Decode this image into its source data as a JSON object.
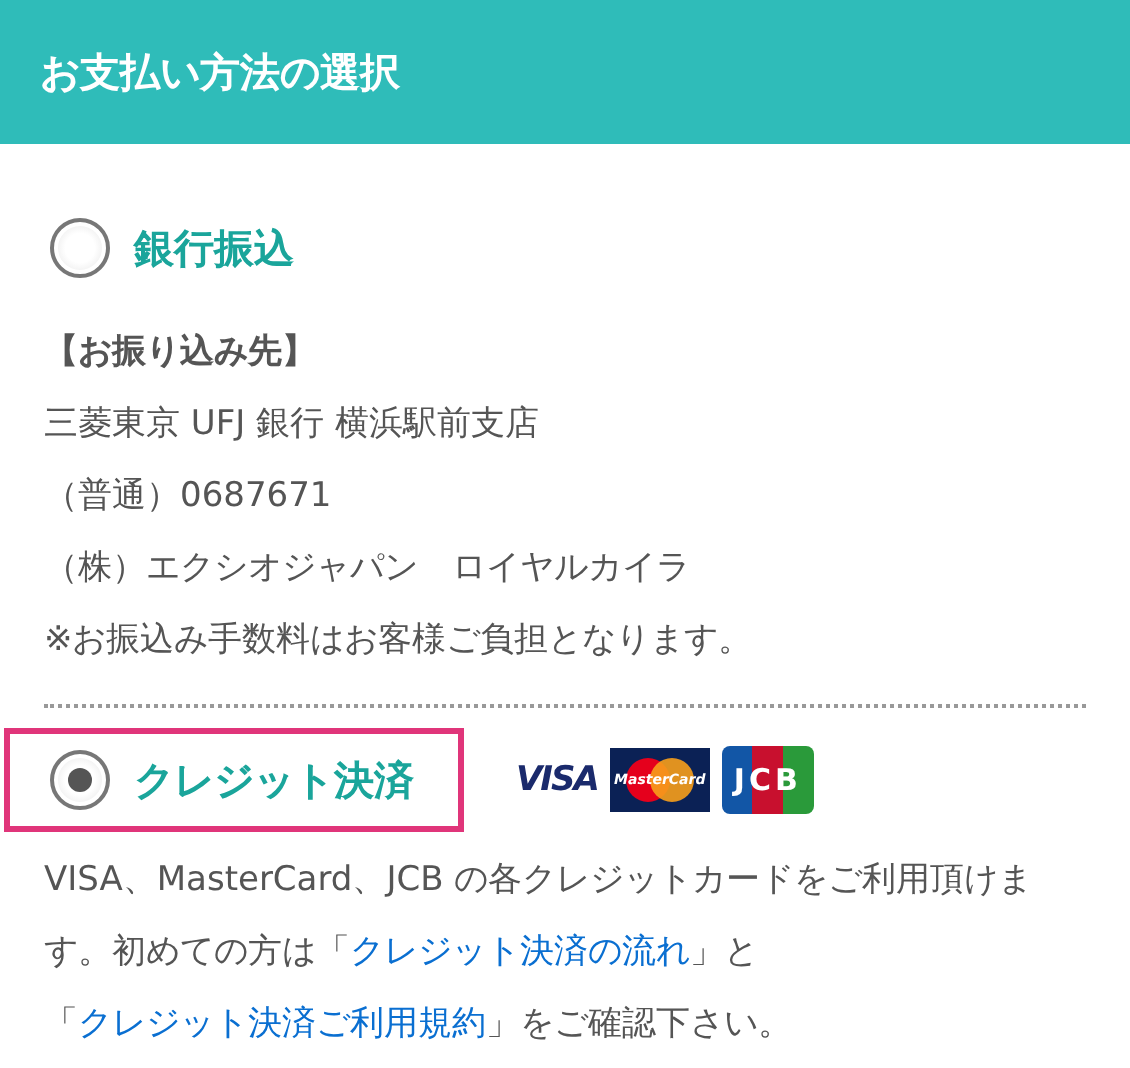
{
  "header": {
    "title": "お支払い方法の選択"
  },
  "options": [
    {
      "label": "銀行振込",
      "selected": false,
      "details": [
        {
          "kind": "heading",
          "text": "【お振り込み先】"
        },
        {
          "kind": "line",
          "text": "三菱東京 UFJ 銀行 横浜駅前支店"
        },
        {
          "kind": "line",
          "text": "（普通）0687671"
        },
        {
          "kind": "line",
          "text": "（株）エクシオジャパン　ロイヤルカイラ"
        },
        {
          "kind": "line",
          "text": "※お振込み手数料はお客様ご負担となります。"
        }
      ]
    },
    {
      "label": "クレジット決済",
      "selected": true,
      "card_logos": [
        {
          "kind": "visa",
          "text": "VISA"
        },
        {
          "kind": "mastercard",
          "text": "MasterCard"
        },
        {
          "kind": "jcb",
          "text": "JCB"
        }
      ],
      "description": [
        {
          "kind": "text",
          "text": "VISA、MasterCard、JCB の各クレジットカードをご利用頂けます。初めての方は「"
        },
        {
          "kind": "link",
          "text": "クレジット決済の流れ"
        },
        {
          "kind": "text",
          "text": "」と「"
        },
        {
          "kind": "link",
          "text": "クレジット決済ご利用規約"
        },
        {
          "kind": "text",
          "text": "」をご確認下さい。"
        }
      ]
    }
  ]
}
